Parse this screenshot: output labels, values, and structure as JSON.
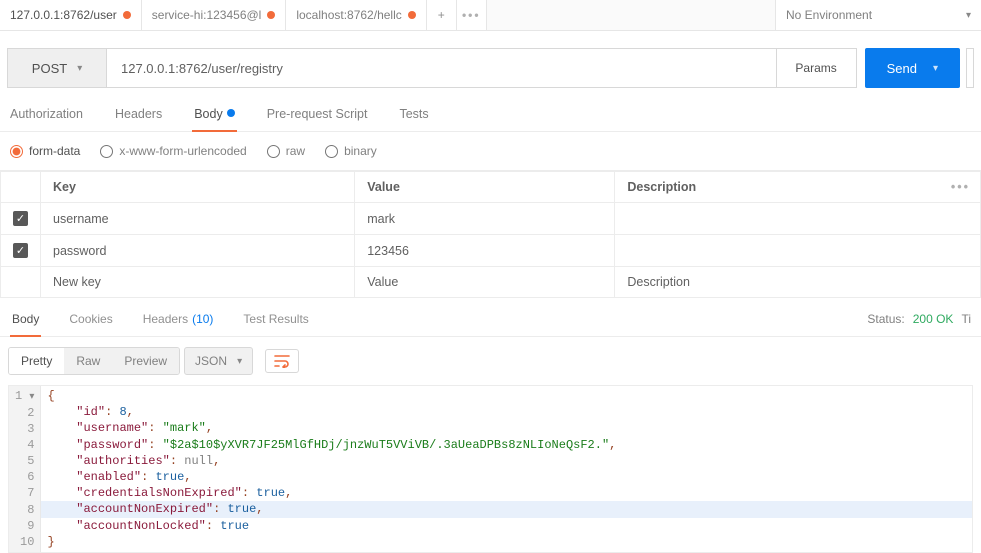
{
  "tabs": [
    {
      "label": "127.0.0.1:8762/user"
    },
    {
      "label": "service-hi:123456@l"
    },
    {
      "label": "localhost:8762/hellc"
    }
  ],
  "environment": {
    "selected": "No Environment"
  },
  "request": {
    "method": "POST",
    "url": "127.0.0.1:8762/user/registry",
    "params_btn": "Params",
    "send_btn": "Send"
  },
  "reqtabs": {
    "authorization": "Authorization",
    "headers": "Headers",
    "body": "Body",
    "prerequest": "Pre-request Script",
    "tests": "Tests"
  },
  "body_types": {
    "formdata": "form-data",
    "urlencoded": "x-www-form-urlencoded",
    "raw": "raw",
    "binary": "binary"
  },
  "kv": {
    "headers": {
      "key": "Key",
      "value": "Value",
      "description": "Description"
    },
    "rows": [
      {
        "checked": true,
        "key": "username",
        "value": "mark",
        "description": ""
      },
      {
        "checked": true,
        "key": "password",
        "value": "123456",
        "description": ""
      }
    ],
    "placeholder": {
      "key": "New key",
      "value": "Value",
      "description": "Description"
    }
  },
  "resptabs": {
    "body": "Body",
    "cookies": "Cookies",
    "headers": "Headers",
    "headers_count": "(10)",
    "testresults": "Test Results"
  },
  "status": {
    "label": "Status:",
    "text": "200 OK",
    "time_label": "Ti"
  },
  "viewer": {
    "pretty": "Pretty",
    "raw": "Raw",
    "preview": "Preview",
    "format": "JSON"
  },
  "response_json": {
    "lines": [
      {
        "n": "1",
        "arrow": true,
        "t": [
          [
            "kw",
            "{"
          ]
        ]
      },
      {
        "n": "2",
        "t": [
          [
            "indent",
            "    "
          ],
          [
            "key",
            "\"id\""
          ],
          [
            "kw",
            ": "
          ],
          [
            "num",
            "8"
          ],
          [
            "kw",
            ","
          ]
        ]
      },
      {
        "n": "3",
        "t": [
          [
            "indent",
            "    "
          ],
          [
            "key",
            "\"username\""
          ],
          [
            "kw",
            ": "
          ],
          [
            "str",
            "\"mark\""
          ],
          [
            "kw",
            ","
          ]
        ]
      },
      {
        "n": "4",
        "t": [
          [
            "indent",
            "    "
          ],
          [
            "key",
            "\"password\""
          ],
          [
            "kw",
            ": "
          ],
          [
            "str",
            "\"$2a$10$yXVR7JF25MlGfHDj/jnzWuT5VViVB/.3aUeaDPBs8zNLIoNeQsF2.\""
          ],
          [
            "kw",
            ","
          ]
        ]
      },
      {
        "n": "5",
        "t": [
          [
            "indent",
            "    "
          ],
          [
            "key",
            "\"authorities\""
          ],
          [
            "kw",
            ": "
          ],
          [
            "null",
            "null"
          ],
          [
            "kw",
            ","
          ]
        ]
      },
      {
        "n": "6",
        "t": [
          [
            "indent",
            "    "
          ],
          [
            "key",
            "\"enabled\""
          ],
          [
            "kw",
            ": "
          ],
          [
            "bool",
            "true"
          ],
          [
            "kw",
            ","
          ]
        ]
      },
      {
        "n": "7",
        "t": [
          [
            "indent",
            "    "
          ],
          [
            "key",
            "\"credentialsNonExpired\""
          ],
          [
            "kw",
            ": "
          ],
          [
            "bool",
            "true"
          ],
          [
            "kw",
            ","
          ]
        ]
      },
      {
        "n": "8",
        "hl": true,
        "t": [
          [
            "indent",
            "    "
          ],
          [
            "key",
            "\"accountNonExpired\""
          ],
          [
            "kw",
            ": "
          ],
          [
            "bool",
            "true"
          ],
          [
            "kw",
            ","
          ]
        ]
      },
      {
        "n": "9",
        "t": [
          [
            "indent",
            "    "
          ],
          [
            "key",
            "\"accountNonLocked\""
          ],
          [
            "kw",
            ": "
          ],
          [
            "bool",
            "true"
          ]
        ]
      },
      {
        "n": "10",
        "t": [
          [
            "kw",
            "}"
          ]
        ]
      }
    ]
  }
}
